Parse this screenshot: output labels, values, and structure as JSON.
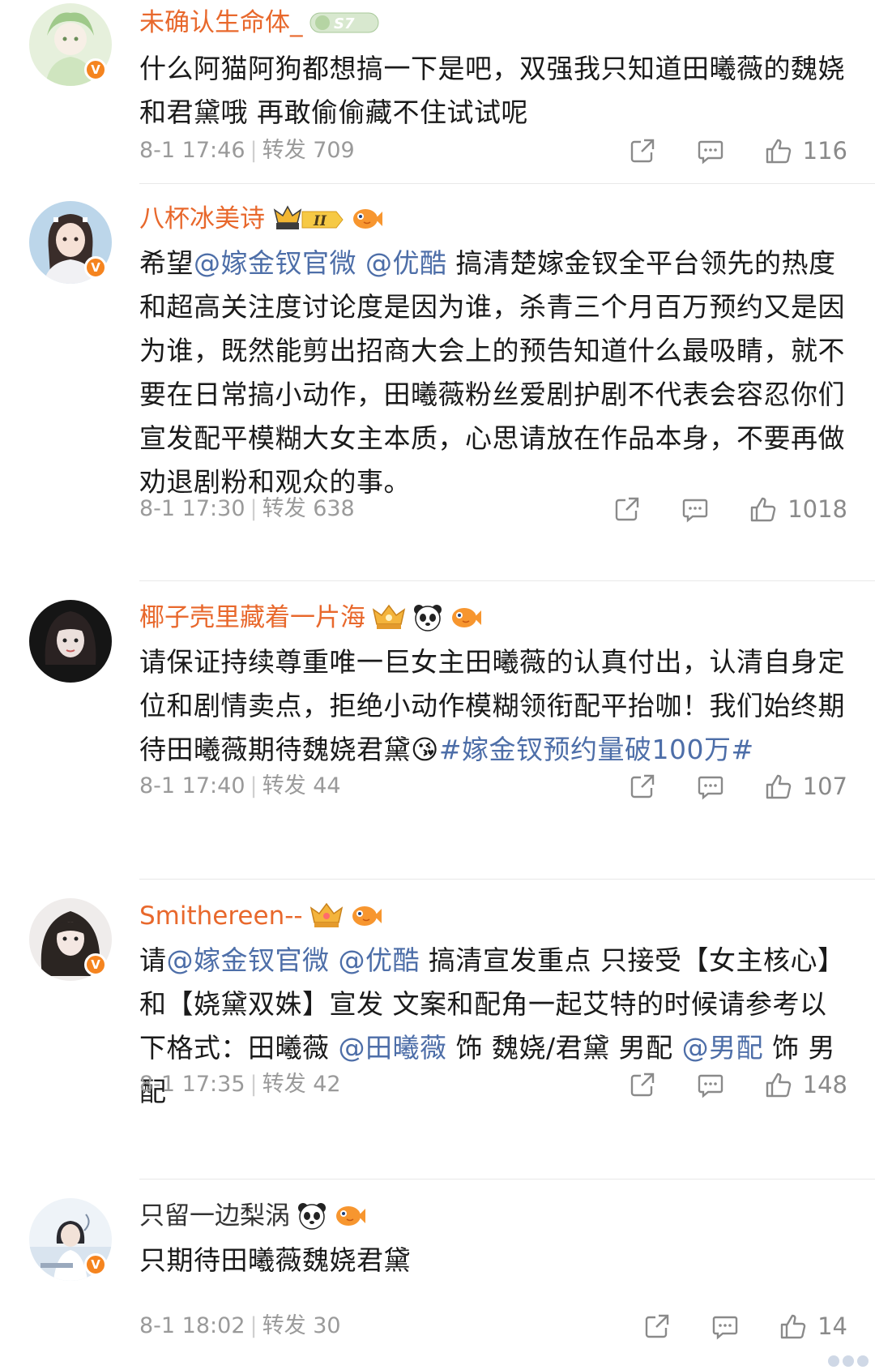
{
  "comments": [
    {
      "username": "未确认生命体_",
      "badges": [
        "level-s7-badge"
      ],
      "body_segments": [
        {
          "type": "text",
          "text": "什么阿猫阿狗都想搞一下是吧，双强我只知道田曦薇的魏娆和君黛哦  再敢偷偷藏不住试试呢"
        }
      ],
      "date": "8-1 17:46",
      "repost_label": "转发",
      "repost_count": "709",
      "like_count": "116"
    },
    {
      "username": "八杯冰美诗",
      "badges": [
        "crown-level-ii-badge",
        "fish-badge"
      ],
      "body_segments": [
        {
          "type": "text",
          "text": "希望"
        },
        {
          "type": "mention",
          "text": "@嫁金钗官微"
        },
        {
          "type": "text",
          "text": " "
        },
        {
          "type": "mention",
          "text": "@优酷"
        },
        {
          "type": "text",
          "text": " 搞清楚嫁金钗全平台领先的热度和超高关注度讨论度是因为谁，杀青三个月百万预约又是因为谁，既然能剪出招商大会上的预告知道什么最吸睛，就不要在日常搞小动作，田曦薇粉丝爱剧护剧不代表会容忍你们宣发配平模糊大女主本质，心思请放在作品本身，不要再做劝退剧粉和观众的事。"
        }
      ],
      "date": "8-1 17:30",
      "repost_label": "转发",
      "repost_count": "638",
      "like_count": "1018"
    },
    {
      "username": "椰子壳里藏着一片海",
      "badges": [
        "crown-badge",
        "panda-badge",
        "fish-badge"
      ],
      "body_segments": [
        {
          "type": "text",
          "text": "请保证持续尊重唯一巨女主田曦薇的认真付出，认清自身定位和剧情卖点，拒绝小动作模糊领衔配平抬咖！我们始终期待田曦薇期待魏娆君黛"
        },
        {
          "type": "emoji",
          "text": "😘"
        },
        {
          "type": "hashtag",
          "text": "#嫁金钗预约量破100万#"
        }
      ],
      "date": "8-1 17:40",
      "repost_label": "转发",
      "repost_count": "44",
      "like_count": "107"
    },
    {
      "username": "Smithereen--",
      "badges": [
        "crown-badge",
        "fish-badge"
      ],
      "body_segments": [
        {
          "type": "text",
          "text": "请"
        },
        {
          "type": "mention",
          "text": "@嫁金钗官微"
        },
        {
          "type": "text",
          "text": " "
        },
        {
          "type": "mention",
          "text": "@优酷"
        },
        {
          "type": "text",
          "text": " 搞清宣发重点 只接受【女主核心】和【娆黛双姝】宣发 文案和配角一起艾特的时候请参考以下格式：田曦薇 "
        },
        {
          "type": "mention",
          "text": "@田曦薇"
        },
        {
          "type": "text",
          "text": " 饰 魏娆/君黛 男配 "
        },
        {
          "type": "mention",
          "text": "@男配"
        },
        {
          "type": "text",
          "text": " 饰 男配"
        }
      ],
      "date": "8-1 17:35",
      "repost_label": "转发",
      "repost_count": "42",
      "like_count": "148"
    },
    {
      "username": "只留一边梨涡",
      "badges": [
        "panda-badge",
        "fish-badge"
      ],
      "body_segments": [
        {
          "type": "text",
          "text": "只期待田曦薇魏娆君黛"
        }
      ],
      "date": "8-1 18:02",
      "repost_label": "转发",
      "repost_count": "30",
      "like_count": "14"
    }
  ],
  "icons": {
    "share": "share-icon",
    "comment": "comment-icon",
    "like": "thumbs-up-icon",
    "verified": "verified-v-badge"
  },
  "colors": {
    "username": "#e8682c",
    "link": "#4d6ea8",
    "meta": "#9a9a9a",
    "verified": "#f5841f"
  }
}
